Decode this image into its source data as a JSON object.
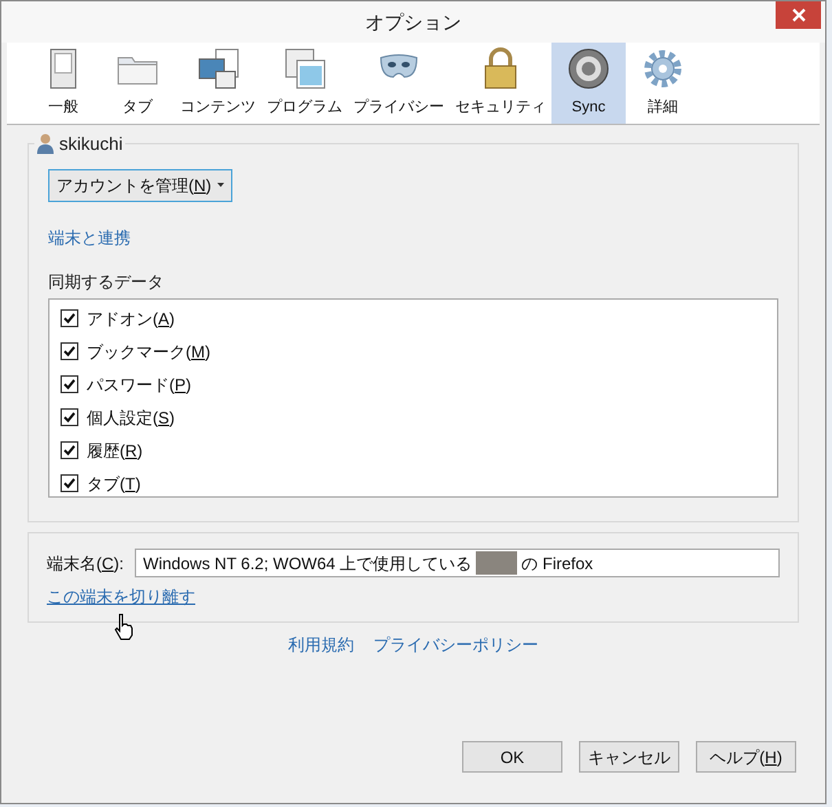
{
  "window": {
    "title": "オプション"
  },
  "tabs": [
    {
      "kind": "general",
      "label": "一般",
      "selected": false
    },
    {
      "kind": "tabs",
      "label": "タブ",
      "selected": false
    },
    {
      "kind": "content",
      "label": "コンテンツ",
      "selected": false
    },
    {
      "kind": "applications",
      "label": "プログラム",
      "selected": false
    },
    {
      "kind": "privacy",
      "label": "プライバシー",
      "selected": false
    },
    {
      "kind": "security",
      "label": "セキュリティ",
      "selected": false
    },
    {
      "kind": "sync",
      "label": "Sync",
      "selected": true
    },
    {
      "kind": "advanced",
      "label": "詳細",
      "selected": false
    }
  ],
  "account": {
    "username": "skikuchi",
    "manage_button": {
      "before": "アカウントを管理(",
      "key": "N",
      "after": ")"
    },
    "pair_link": "端末と連携"
  },
  "sync_data": {
    "label": "同期するデータ",
    "items": [
      {
        "before": "アドオン(",
        "key": "A",
        "after": ")",
        "checked": true
      },
      {
        "before": "ブックマーク(",
        "key": "M",
        "after": ")",
        "checked": true
      },
      {
        "before": "パスワード(",
        "key": "P",
        "after": ")",
        "checked": true
      },
      {
        "before": "個人設定(",
        "key": "S",
        "after": ")",
        "checked": true
      },
      {
        "before": "履歴(",
        "key": "R",
        "after": ")",
        "checked": true
      },
      {
        "before": "タブ(",
        "key": "T",
        "after": ")",
        "checked": true
      }
    ]
  },
  "device": {
    "label": {
      "before": "端末名(",
      "key": "C",
      "after": "):"
    },
    "value_before": "Windows NT 6.2; WOW64 上で使用している",
    "value_after": "の Firefox",
    "unlink": "この端末を切り離す"
  },
  "footer_links": [
    "利用規約",
    "プライバシーポリシー"
  ],
  "buttons": [
    {
      "before": "OK"
    },
    {
      "before": "キャンセル"
    },
    {
      "before": "ヘルプ(",
      "key": "H",
      "after": ")"
    }
  ]
}
